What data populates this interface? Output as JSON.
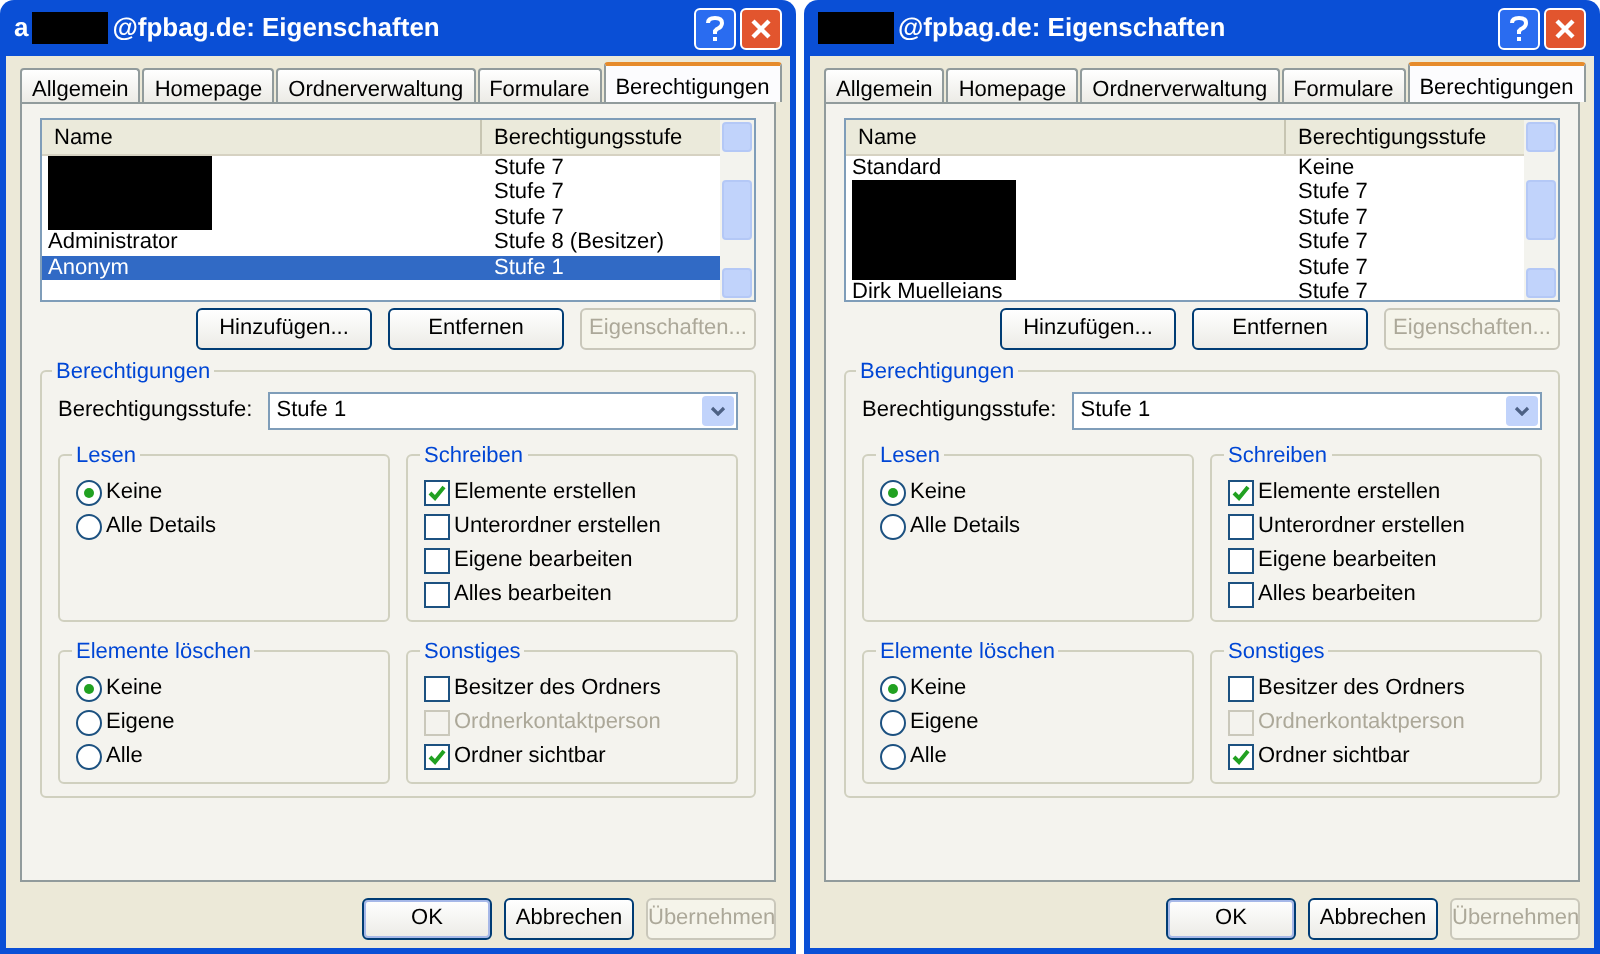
{
  "dialogs": [
    {
      "title": "@fpbag.de: Eigenschaften",
      "title_prefix": "a",
      "tabs": [
        {
          "label": "Allgemein",
          "selected": false
        },
        {
          "label": "Homepage",
          "selected": false
        },
        {
          "label": "Ordnerverwaltung",
          "selected": false
        },
        {
          "label": "Formulare",
          "selected": false
        },
        {
          "label": "Berechtigungen",
          "selected": true
        }
      ],
      "list": {
        "columns": [
          "Name",
          "Berechtigungsstufe"
        ],
        "rows": [
          {
            "redacted": true,
            "level": "Stufe 7",
            "selected": false
          },
          {
            "redacted": true,
            "level": "Stufe 7",
            "selected": false
          },
          {
            "redacted": true,
            "level": "Stufe 7",
            "selected": false
          },
          {
            "name": "Administrator",
            "level": "Stufe 8 (Besitzer)",
            "selected": false
          },
          {
            "name": "Anonym",
            "level": "Stufe 1",
            "selected": true
          }
        ]
      },
      "list_buttons": [
        {
          "label": "Hinzufügen...",
          "disabled": false
        },
        {
          "label": "Entfernen",
          "disabled": false
        },
        {
          "label": "Eigenschaften...",
          "disabled": true
        }
      ],
      "permissions": {
        "title": "Berechtigungen",
        "level_label": "Berechtigungsstufe:",
        "level_value": "Stufe 1",
        "groups": [
          {
            "title": "Lesen",
            "kind": "radio",
            "items": [
              {
                "label": "Keine",
                "selected": true
              },
              {
                "label": "Alle Details",
                "selected": false
              }
            ]
          },
          {
            "title": "Schreiben",
            "kind": "checkbox",
            "items": [
              {
                "label": "Elemente erstellen",
                "checked": true,
                "disabled": false
              },
              {
                "label": "Unterordner erstellen",
                "checked": false,
                "disabled": false
              },
              {
                "label": "Eigene bearbeiten",
                "checked": false,
                "disabled": false
              },
              {
                "label": "Alles bearbeiten",
                "checked": false,
                "disabled": false
              }
            ]
          },
          {
            "title": "Elemente löschen",
            "kind": "radio",
            "items": [
              {
                "label": "Keine",
                "selected": true
              },
              {
                "label": "Eigene",
                "selected": false
              },
              {
                "label": "Alle",
                "selected": false
              }
            ]
          },
          {
            "title": "Sonstiges",
            "kind": "checkbox",
            "items": [
              {
                "label": "Besitzer des Ordners",
                "checked": false,
                "disabled": false
              },
              {
                "label": "Ordnerkontaktperson",
                "checked": false,
                "disabled": true
              },
              {
                "label": "Ordner sichtbar",
                "checked": true,
                "disabled": false
              }
            ]
          }
        ]
      },
      "footer_buttons": [
        {
          "label": "OK",
          "disabled": false,
          "default": true
        },
        {
          "label": "Abbrechen",
          "disabled": false,
          "default": false
        },
        {
          "label": "Übernehmen",
          "disabled": true,
          "default": false
        }
      ]
    },
    {
      "title": "@fpbag.de: Eigenschaften",
      "tabs": [
        {
          "label": "Allgemein",
          "selected": false
        },
        {
          "label": "Homepage",
          "selected": false
        },
        {
          "label": "Ordnerverwaltung",
          "selected": false
        },
        {
          "label": "Formulare",
          "selected": false
        },
        {
          "label": "Berechtigungen",
          "selected": true
        }
      ],
      "list": {
        "columns": [
          "Name",
          "Berechtigungsstufe"
        ],
        "rows": [
          {
            "name": "Standard",
            "level": "Keine",
            "selected": false
          },
          {
            "redacted": true,
            "level": "Stufe 7",
            "selected": false
          },
          {
            "redacted": true,
            "level": "Stufe 7",
            "selected": false
          },
          {
            "redacted": true,
            "level": "Stufe 7",
            "selected": false
          },
          {
            "redacted": true,
            "level": "Stufe 7",
            "selected": false
          },
          {
            "name": "Dirk Muelleians",
            "level": "Stufe 7",
            "selected": false
          }
        ]
      },
      "list_buttons": [
        {
          "label": "Hinzufügen...",
          "disabled": false
        },
        {
          "label": "Entfernen",
          "disabled": false
        },
        {
          "label": "Eigenschaften...",
          "disabled": true
        }
      ],
      "permissions": {
        "title": "Berechtigungen",
        "level_label": "Berechtigungsstufe:",
        "level_value": "Stufe 1",
        "groups": [
          {
            "title": "Lesen",
            "kind": "radio",
            "items": [
              {
                "label": "Keine",
                "selected": true
              },
              {
                "label": "Alle Details",
                "selected": false
              }
            ]
          },
          {
            "title": "Schreiben",
            "kind": "checkbox",
            "items": [
              {
                "label": "Elemente erstellen",
                "checked": true,
                "disabled": false
              },
              {
                "label": "Unterordner erstellen",
                "checked": false,
                "disabled": false
              },
              {
                "label": "Eigene bearbeiten",
                "checked": false,
                "disabled": false
              },
              {
                "label": "Alles bearbeiten",
                "checked": false,
                "disabled": false
              }
            ]
          },
          {
            "title": "Elemente löschen",
            "kind": "radio",
            "items": [
              {
                "label": "Keine",
                "selected": true
              },
              {
                "label": "Eigene",
                "selected": false
              },
              {
                "label": "Alle",
                "selected": false
              }
            ]
          },
          {
            "title": "Sonstiges",
            "kind": "checkbox",
            "items": [
              {
                "label": "Besitzer des Ordners",
                "checked": false,
                "disabled": false
              },
              {
                "label": "Ordnerkontaktperson",
                "checked": false,
                "disabled": true
              },
              {
                "label": "Ordner sichtbar",
                "checked": true,
                "disabled": false
              }
            ]
          }
        ]
      },
      "footer_buttons": [
        {
          "label": "OK",
          "disabled": false,
          "default": true
        },
        {
          "label": "Abbrechen",
          "disabled": false,
          "default": false
        },
        {
          "label": "Übernehmen",
          "disabled": true,
          "default": false
        }
      ]
    }
  ]
}
